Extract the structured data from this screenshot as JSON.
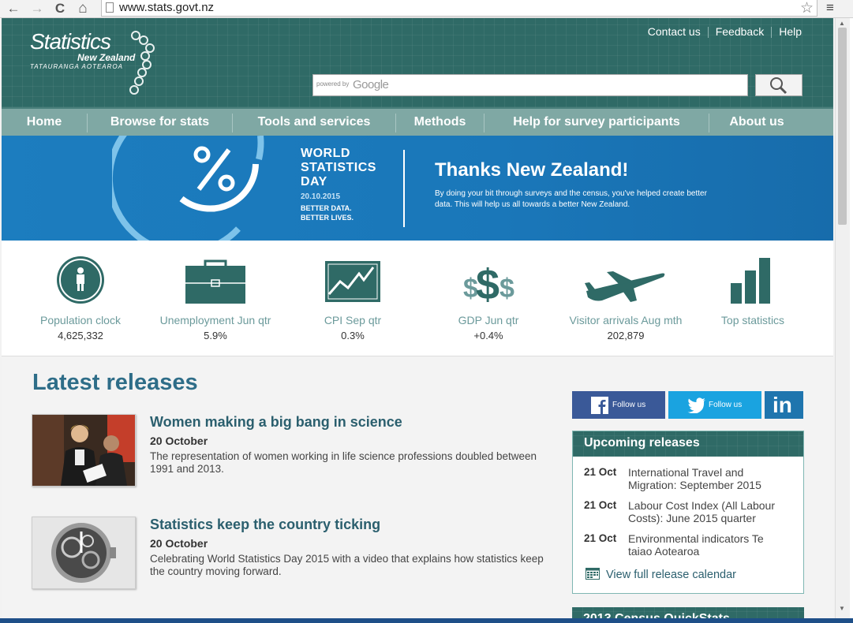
{
  "browser": {
    "back": "←",
    "forward": "→",
    "reload": "C",
    "home": "⌂",
    "url": "www.stats.govt.nz",
    "star": "☆",
    "menu": "≡"
  },
  "header": {
    "logo_line1": "Statistics",
    "logo_line2": "New Zealand",
    "logo_line3": "TATAURANGA AOTEAROA",
    "links": [
      "Contact us",
      "Feedback",
      "Help"
    ],
    "search_powered": "powered by",
    "search_google": "Google"
  },
  "nav": [
    "Home",
    "Browse for stats",
    "Tools and services",
    "Methods",
    "Help for survey participants",
    "About us"
  ],
  "banner": {
    "wsd_line1": "WORLD",
    "wsd_line2": "STATISTICS",
    "wsd_line3": "DAY",
    "date": "20.10.2015",
    "better1": "BETTER DATA.",
    "better2": "BETTER LIVES.",
    "title": "Thanks New Zealand!",
    "subtitle": "By doing your bit through surveys and the census, you've helped create better data. This will help us all towards a better New Zealand."
  },
  "stats": [
    {
      "label": "Population clock",
      "value": "4,625,332"
    },
    {
      "label": "Unemployment Jun qtr",
      "value": "5.9%"
    },
    {
      "label": "CPI Sep qtr",
      "value": "0.3%"
    },
    {
      "label": "GDP Jun qtr",
      "value": "+0.4%"
    },
    {
      "label": "Visitor arrivals Aug mth",
      "value": "202,879"
    },
    {
      "label": "Top statistics",
      "value": ""
    }
  ],
  "latest": {
    "title": "Latest releases",
    "items": [
      {
        "title": "Women making a big bang in science",
        "date": "20 October",
        "text": "The representation of women working in life science professions doubled between 1991 and 2013."
      },
      {
        "title": "Statistics keep the country ticking",
        "date": "20 October",
        "text": "Celebrating World Statistics Day 2015 with a video that explains how statistics keep the country moving forward."
      }
    ]
  },
  "social": {
    "facebook": "Follow us",
    "twitter": "Follow us",
    "linkedin": "in"
  },
  "upcoming": {
    "title": "Upcoming releases",
    "items": [
      {
        "date": "21 Oct",
        "text": "International Travel and Migration: September 2015"
      },
      {
        "date": "21 Oct",
        "text": "Labour Cost Index (All Labour Costs): June 2015 quarter"
      },
      {
        "date": "21 Oct",
        "text": "Environmental indicators Te taiao Aotearoa"
      }
    ],
    "calendar_link": "View full release calendar"
  },
  "census": {
    "title": "2013 Census QuickStats"
  },
  "colors": {
    "teal": "#2f6a66",
    "nav": "#7fa8a4",
    "banner": "#1c7dbf",
    "heading": "#2e6d88"
  }
}
